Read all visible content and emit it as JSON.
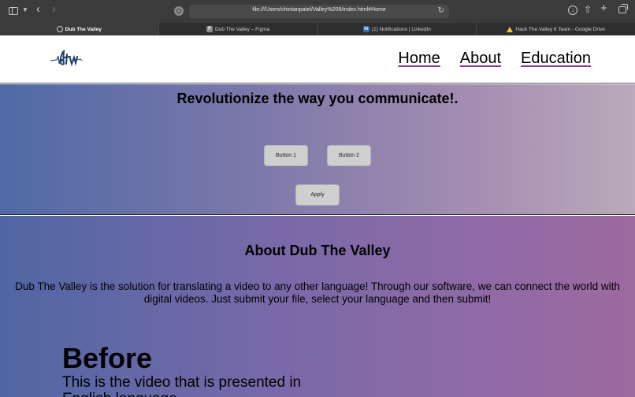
{
  "browser": {
    "address": "file:///Users/chintanpatel/Valley%208/index.html#Home",
    "tabs": [
      {
        "label": "Dub The Valley",
        "icon": "compass-icon",
        "active": true
      },
      {
        "label": "Dub The Valley – Figma",
        "icon": "figma-icon",
        "active": false
      },
      {
        "label": "(1) Notifications | LinkedIn",
        "icon": "linkedin-icon",
        "active": false
      },
      {
        "label": "Hack The Valley 8 Team - Google Drive",
        "icon": "google-drive-icon",
        "active": false
      }
    ],
    "icons": {
      "sidebar": "sidebar-icon",
      "back": "back-arrow-icon",
      "forward": "forward-arrow-icon",
      "reload": "reload-icon",
      "download": "download-icon",
      "share": "share-icon",
      "new_tab": "plus-icon",
      "tab_overview": "tab-overview-icon"
    }
  },
  "header": {
    "logo_icon": "dtv-logo",
    "nav": [
      {
        "label": "Home"
      },
      {
        "label": "About"
      },
      {
        "label": "Education"
      }
    ]
  },
  "hero": {
    "title": "Revolutionize the way you communicate!.",
    "button1": "Button 1",
    "button2": "Button 2",
    "apply": "Apply"
  },
  "about": {
    "title": "About Dub The Valley",
    "text": "Dub The Valley is the solution for translating a video to any other language! Through our software, we can connect the world with digital videos. Just submit your file, select your language and then submit!",
    "before_title": "Before",
    "before_text": "This is the video that is presented in English language"
  },
  "colors": {
    "nav_underline": "#8c3a8c",
    "hero_gradient_start": "#4f6aa6",
    "hero_gradient_end": "#baa9bb",
    "about_gradient_start": "#5066a4",
    "about_gradient_end": "#9e6aa0"
  }
}
